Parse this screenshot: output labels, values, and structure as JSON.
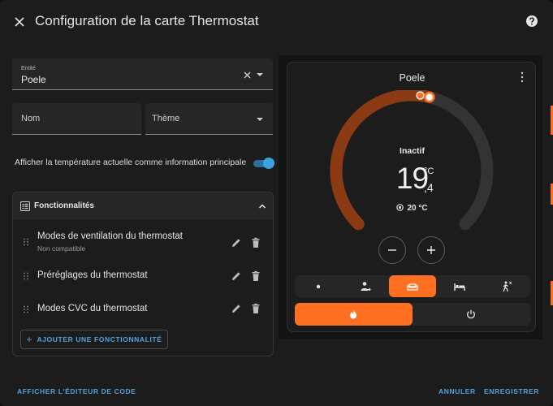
{
  "dialog": {
    "title": "Configuration de la carte Thermostat"
  },
  "form": {
    "entity": {
      "label": "Entité",
      "value": "Poele"
    },
    "name": {
      "placeholder": "Nom"
    },
    "theme": {
      "placeholder": "Thème"
    },
    "show_current_toggle": {
      "label": "Afficher la température actuelle comme information principale",
      "on": true
    }
  },
  "features": {
    "title": "Fonctionnalités",
    "items": [
      {
        "name": "Modes de ventilation du thermostat",
        "subtitle": "Non compatible"
      },
      {
        "name": "Préréglages du thermostat"
      },
      {
        "name": "Modes CVC du thermostat"
      }
    ],
    "add_label": "AJOUTER UNE FONCTIONNALITÉ"
  },
  "preview": {
    "title": "Poele",
    "state": "Inactif",
    "temp_int": "19",
    "temp_unit": "°C",
    "temp_dec": ",4",
    "target": "20 °C",
    "progress_fraction": 0.55,
    "active_mode_index": 2,
    "active_hvac_index": 0
  },
  "footer": {
    "code_editor": "AFFICHER L'ÉDITEUR DE CODE",
    "cancel": "ANNULER",
    "save": "ENREGISTRER"
  },
  "colors": {
    "accent": "#ff6f22",
    "arc_active": "#8b3a14",
    "primary": "#4fa3e0",
    "background": "#1c1c1c"
  }
}
